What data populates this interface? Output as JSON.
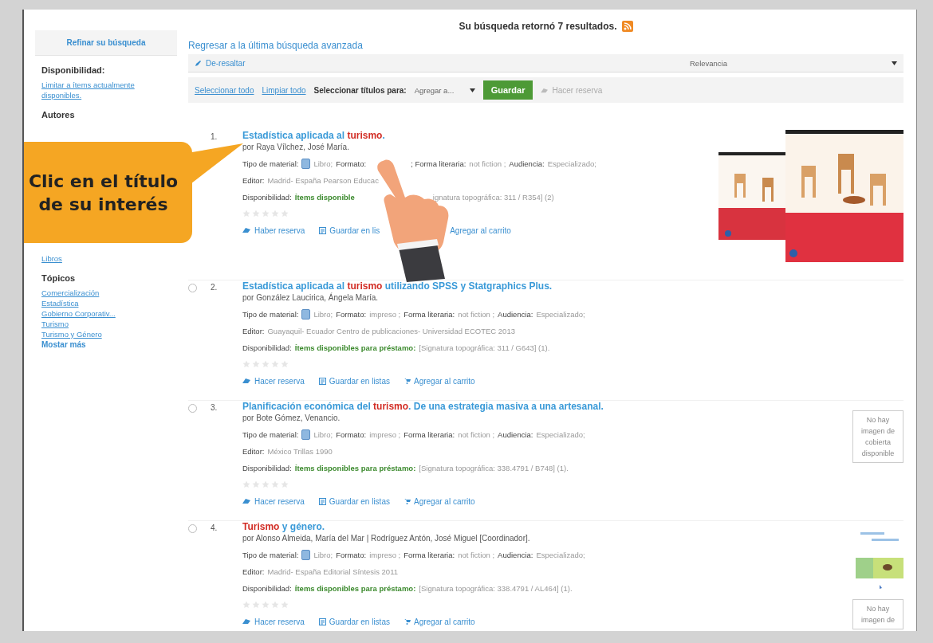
{
  "summary": "Su búsqueda retornó 7 resultados.",
  "back_link": "Regresar a la última búsqueda avanzada",
  "toolbar": {
    "unhighlight": "De-resaltar",
    "sort": "Relevancia",
    "select_all": "Seleccionar todo",
    "clear_all": "Limpiar todo",
    "select_label": "Seleccionar títulos para:",
    "add_to": "Agregar a...",
    "save": "Guardar",
    "reserve": "Hacer reserva"
  },
  "sidebar": {
    "title": "Refinar su búsqueda",
    "sections": [
      {
        "heading": "Disponibilidad:",
        "links": [
          "Limitar a ítems actualmente disponibles."
        ]
      },
      {
        "heading": "Autores"
      },
      {
        "links": [
          "Libros"
        ]
      },
      {
        "heading": "Tópicos",
        "links": [
          "Comercialización",
          "Estadística",
          "Gobierno Corporativ...",
          "Turismo",
          "Turismo y Género"
        ],
        "more": "Mostar más"
      }
    ]
  },
  "callout": "Clic en el título de su interés",
  "results": [
    {
      "number": "1.",
      "title": [
        {
          "text": "Estadística aplicada al ",
          "highlight": false
        },
        {
          "text": "turismo",
          "highlight": true
        },
        {
          "text": ".",
          "highlight": false
        }
      ],
      "author": "por Raya Vílchez, José María.",
      "stars": 0,
      "lines": [
        [
          {
            "kind": "label",
            "text": "Tipo de material:"
          },
          {
            "kind": "icon"
          },
          {
            "kind": "value",
            "text": "Libro;"
          },
          {
            "kind": "label",
            "text": "Formato:"
          },
          {
            "kind": "covered"
          },
          {
            "kind": "label",
            "text": "; Forma literaria:"
          },
          {
            "kind": "value",
            "text": "not fiction ;"
          },
          {
            "kind": "label",
            "text": "Audiencia:"
          },
          {
            "kind": "value",
            "text": "Especializado;"
          }
        ],
        [
          {
            "kind": "label",
            "text": "Editor:"
          },
          {
            "kind": "value",
            "text": "Madrid- España Pearson Educac"
          },
          {
            "kind": "covered"
          }
        ],
        [
          {
            "kind": "label",
            "text": "Disponibilidad:"
          },
          {
            "kind": "avail",
            "text": "Ítems disponible"
          },
          {
            "kind": "covered"
          },
          {
            "kind": "value",
            "text": "ignatura topográfica: 311 / R354] (2)"
          }
        ]
      ],
      "actions": [
        {
          "kind": "reserve",
          "text": "Haber reserva"
        },
        {
          "kind": "lists",
          "text": "Guardar en lis"
        },
        {
          "kind": "covered"
        },
        {
          "kind": "plain",
          "text": "Agregar al carrito"
        }
      ],
      "covers": [
        {
          "kind": "picture"
        }
      ]
    },
    {
      "number": "2.",
      "checked": false,
      "title": [
        {
          "text": "Estadística aplicada al ",
          "highlight": false
        },
        {
          "text": "turismo",
          "highlight": true
        },
        {
          "text": " utilizando SPSS y Statgraphics Plus.",
          "highlight": false
        }
      ],
      "author": "por González Laucirica, Ángela María.",
      "stars": 0,
      "lines": [
        [
          {
            "kind": "label",
            "text": "Tipo de material:"
          },
          {
            "kind": "icon"
          },
          {
            "kind": "value",
            "text": "Libro;"
          },
          {
            "kind": "label",
            "text": "Formato:"
          },
          {
            "kind": "value",
            "text": "impreso ;"
          },
          {
            "kind": "label",
            "text": "Forma literaria:"
          },
          {
            "kind": "value",
            "text": "not fiction ;"
          },
          {
            "kind": "label",
            "text": "Audiencia:"
          },
          {
            "kind": "value",
            "text": "Especializado;"
          }
        ],
        [
          {
            "kind": "label",
            "text": "Editor:"
          },
          {
            "kind": "value",
            "text": "Guayaquil- Ecuador Centro de publicaciones- Universidad ECOTEC 2013"
          }
        ],
        [
          {
            "kind": "label",
            "text": "Disponibilidad:"
          },
          {
            "kind": "avail",
            "text": "Ítems disponibles para préstamo:"
          },
          {
            "kind": "value",
            "text": "[Signatura topográfica: 311 / G643] (1)."
          }
        ]
      ],
      "actions": [
        {
          "kind": "reserve",
          "text": "Hacer reserva"
        },
        {
          "kind": "lists",
          "text": "Guardar en listas"
        },
        {
          "kind": "cart",
          "text": "Agregar al carrito"
        }
      ]
    },
    {
      "number": "3.",
      "checked": false,
      "title": [
        {
          "text": "Planificación económica del ",
          "highlight": false
        },
        {
          "text": "turismo",
          "highlight": true
        },
        {
          "text": ". De una estrategia masiva a una artesanal.",
          "highlight": false
        }
      ],
      "author": "por Bote Gómez, Venancio.",
      "stars": 0,
      "lines": [
        [
          {
            "kind": "label",
            "text": "Tipo de material:"
          },
          {
            "kind": "icon"
          },
          {
            "kind": "value",
            "text": "Libro;"
          },
          {
            "kind": "label",
            "text": "Formato:"
          },
          {
            "kind": "value",
            "text": "impreso ;"
          },
          {
            "kind": "label",
            "text": "Forma literaria:"
          },
          {
            "kind": "value",
            "text": "not fiction ;"
          },
          {
            "kind": "label",
            "text": "Audiencia:"
          },
          {
            "kind": "value",
            "text": "Especializado;"
          }
        ],
        [
          {
            "kind": "label",
            "text": "Editor:"
          },
          {
            "kind": "value",
            "text": "México Trillas 1990"
          }
        ],
        [
          {
            "kind": "label",
            "text": "Disponibilidad:"
          },
          {
            "kind": "avail",
            "text": "Ítems disponibles para préstamo:"
          },
          {
            "kind": "value",
            "text": "[Signatura topográfica: 338.4791 / B748] (1)."
          }
        ]
      ],
      "actions": [
        {
          "kind": "reserve",
          "text": "Hacer reserva"
        },
        {
          "kind": "lists",
          "text": "Guardar en listas"
        },
        {
          "kind": "cart",
          "text": "Agregar al carrito"
        }
      ],
      "covers": [
        {
          "kind": "no_image",
          "text": "No hay imagen de cobierta disponible"
        }
      ]
    },
    {
      "number": "4.",
      "checked": false,
      "title": [
        {
          "text": "Turismo",
          "highlight": true
        },
        {
          "text": " y género.",
          "highlight": false
        }
      ],
      "author": "por Alonso Almeida, María del Mar | Rodríguez Antón, José Miguel [Coordinador].",
      "stars": 0,
      "lines": [
        [
          {
            "kind": "label",
            "text": "Tipo de material:"
          },
          {
            "kind": "icon"
          },
          {
            "kind": "value",
            "text": "Libro;"
          },
          {
            "kind": "label",
            "text": "Formato:"
          },
          {
            "kind": "value",
            "text": "impreso ;"
          },
          {
            "kind": "label",
            "text": "Forma literaria:"
          },
          {
            "kind": "value",
            "text": "not fiction ;"
          },
          {
            "kind": "label",
            "text": "Audiencia:"
          },
          {
            "kind": "value",
            "text": "Especializado;"
          }
        ],
        [
          {
            "kind": "label",
            "text": "Editor:"
          },
          {
            "kind": "value",
            "text": "Madrid- España Editorial Síntesis 2011"
          }
        ],
        [
          {
            "kind": "label",
            "text": "Disponibilidad:"
          },
          {
            "kind": "avail",
            "text": "Ítems disponibles para préstamo:"
          },
          {
            "kind": "value",
            "text": "[Signatura topográfica: 338.4791 / AL464] (1)."
          }
        ]
      ],
      "actions": [
        {
          "kind": "reserve",
          "text": "Hacer reserva"
        },
        {
          "kind": "lists",
          "text": "Guardar en listas"
        },
        {
          "kind": "cart",
          "text": "Agregar al carrito"
        }
      ],
      "covers": [
        {
          "kind": "picture"
        },
        {
          "kind": "no_image",
          "text": "No hay imagen de"
        }
      ]
    }
  ]
}
